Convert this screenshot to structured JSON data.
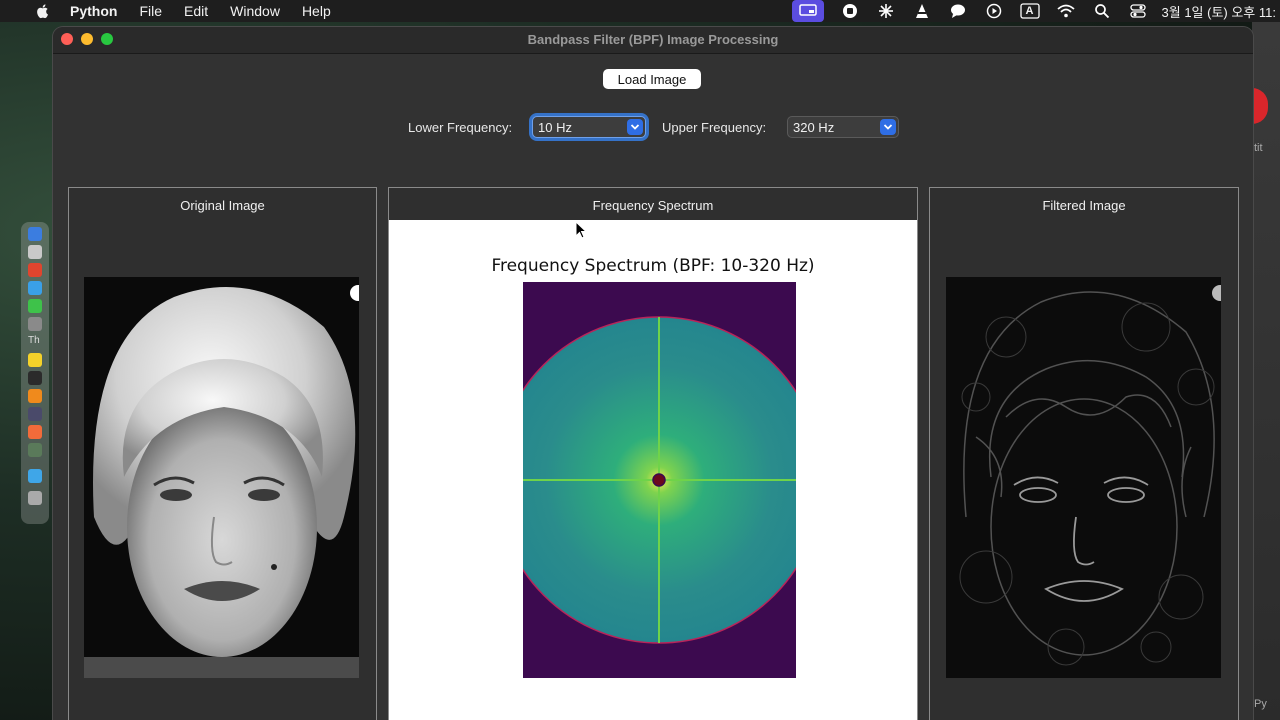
{
  "menubar": {
    "app_name": "Python",
    "items": [
      "File",
      "Edit",
      "Window",
      "Help"
    ],
    "clock": "3월 1일 (토) 오후 11:",
    "status_icons": [
      "screen-share-icon",
      "record-icon",
      "sparkle-icon",
      "vlc-icon",
      "chat-bubble-icon",
      "play-circle-icon",
      "input-source-icon",
      "wifi-icon",
      "search-icon",
      "control-center-icon"
    ],
    "input_source_label": "A"
  },
  "window": {
    "title": "Bandpass Filter (BPF) Image Processing"
  },
  "toolbar": {
    "load_label": "Load Image",
    "lower_label": "Lower Frequency:",
    "lower_value": "10 Hz",
    "upper_label": "Upper Frequency:",
    "upper_value": "320 Hz"
  },
  "panels": {
    "original_title": "Original Image",
    "spectrum_title": "Frequency Spectrum",
    "filtered_title": "Filtered Image",
    "plot_title": "Frequency Spectrum (BPF: 10-320 Hz)"
  },
  "side_fragments": [
    "tit",
    "Py"
  ],
  "colors": {
    "window_bg": "#323232",
    "accent_blue": "#2f6ee5",
    "focus_ring": "#3572c8",
    "spectrum_outside": "#3c0a4f",
    "spectrum_ring": "#2a8a8a",
    "spectrum_center": "#f5e85a"
  }
}
